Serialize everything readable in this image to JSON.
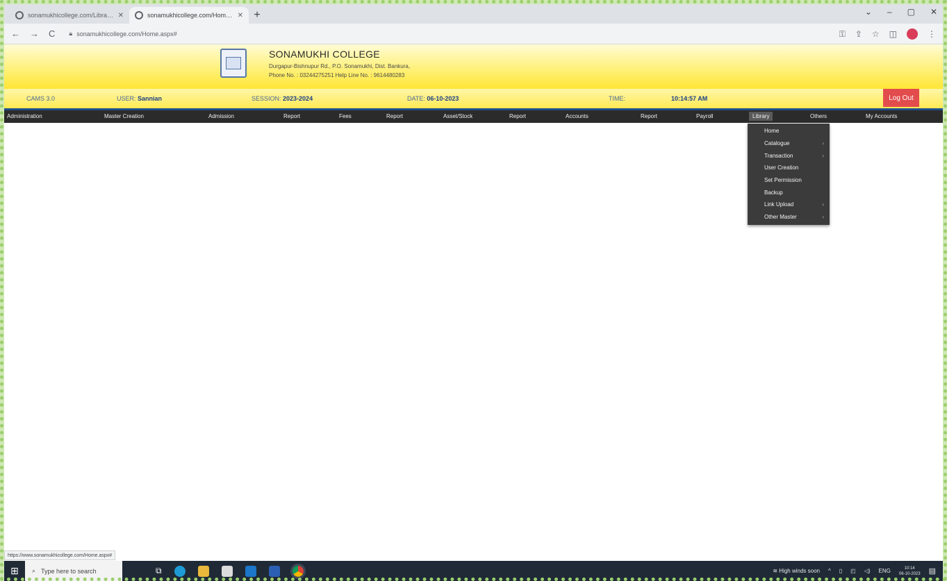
{
  "browser": {
    "tabs": [
      {
        "title": "sonamukhicollege.com/Library/...",
        "active": false
      },
      {
        "title": "sonamukhicollege.com/Home.a...",
        "active": true
      }
    ],
    "new_tab": "+",
    "window_controls": {
      "minimize": "–",
      "restore": "▢",
      "close": "✕",
      "chevron": "⌄"
    },
    "url": "sonamukhicollege.com/Home.aspx#",
    "back": "←",
    "forward": "→",
    "reload": "C"
  },
  "site": {
    "college_name": "SONAMUKHI COLLEGE",
    "address": "Durgapur-Bishnupur Rd., P.O. Sonamukhi, Dist. Bankura,",
    "phone": "Phone No. : 03244275251 Help Line No. : 9614480283"
  },
  "infobar": {
    "cams_label": "CAMS 3.0",
    "user_label": "USER:",
    "user_value": "Sannian",
    "session_label": "SESSION:",
    "session_value": "2023-2024",
    "date_label": "DATE:",
    "date_value": "06-10-2023",
    "time_label": "TIME:",
    "time_value": "10:14:57 AM",
    "logout": "Log Out"
  },
  "menu": {
    "items": [
      "Administration",
      "Master Creation",
      "Admission",
      "Report",
      "Fees",
      "Report",
      "Asset/Stock",
      "Report",
      "Accounts",
      "Report",
      "Payroll",
      "Library",
      "Others",
      "My Accounts"
    ],
    "active_index": 11
  },
  "library_dropdown": [
    {
      "label": "Home",
      "submenu": false
    },
    {
      "label": "Catalogue",
      "submenu": true
    },
    {
      "label": "Transaction",
      "submenu": true
    },
    {
      "label": "User Creation",
      "submenu": false
    },
    {
      "label": "Set Permission",
      "submenu": false
    },
    {
      "label": "Backup",
      "submenu": false
    },
    {
      "label": "Link Upload",
      "submenu": true
    },
    {
      "label": "Other Master",
      "submenu": true
    }
  ],
  "status_url": "https://www.sonamukhicollege.com/Home.aspx#",
  "taskbar": {
    "search_placeholder": "Type here to search",
    "weather": "High winds soon",
    "lang": "ENG",
    "time": "10:14",
    "date": "06-10-2023"
  },
  "colors": {
    "header_yellow": "#ffe636",
    "menubar": "#2b2b2b",
    "logout_red": "#e24c4c",
    "dropdown_bg": "#3b3b3b"
  }
}
